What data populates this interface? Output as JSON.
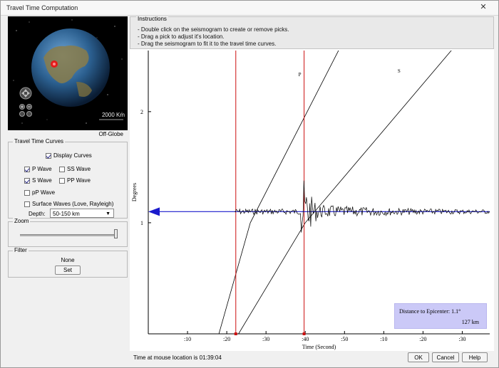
{
  "window": {
    "title": "Travel Time Computation",
    "close_glyph": "✕"
  },
  "globe": {
    "scale_label": "2000 Km",
    "caption": "Off-Globe"
  },
  "travel_time_curves": {
    "label": "Travel Time Curves",
    "display_curves": {
      "label": "Display Curves",
      "checked": true
    },
    "p_wave": {
      "label": "P Wave",
      "checked": true
    },
    "ss_wave": {
      "label": "SS Wave",
      "checked": false
    },
    "s_wave": {
      "label": "S Wave",
      "checked": true
    },
    "pp_wave": {
      "label": "PP Wave",
      "checked": false
    },
    "pp_small": {
      "label": "pP Wave",
      "checked": false
    },
    "surface_waves": {
      "label": "Surface Waves (Love, Rayleigh)",
      "checked": false
    },
    "depth_label": "Depth:",
    "depth_value": "50-150 km"
  },
  "zoom": {
    "label": "Zoom",
    "level": 1.0
  },
  "filter": {
    "label": "Filter",
    "value": "None",
    "set_label": "Set"
  },
  "instructions": {
    "label": "Instructions",
    "lines": [
      "- Double click on the seismogram to create or remove picks.",
      "- Drag a pick to adjust it's location.",
      "- Drag the seismogram to fit it to the travel time curves."
    ]
  },
  "chart_data": {
    "type": "line",
    "xlabel": "Time  (Second)",
    "ylabel": "Degrees",
    "x_tick_labels": [
      ":10",
      ":20",
      ":30",
      ":40",
      ":50",
      ":10",
      ":20",
      ":30"
    ],
    "x_ticks": [
      10,
      20,
      30,
      40,
      50,
      60,
      70,
      80
    ],
    "y_ticks": [
      1,
      2
    ],
    "xlim": [
      0,
      87
    ],
    "ylim": [
      0.0,
      2.55
    ],
    "curves": [
      {
        "name": "P",
        "x": [
          18,
          26,
          55
        ],
        "y": [
          0.0,
          1.0,
          3.0
        ]
      },
      {
        "name": "S",
        "x": [
          23,
          40,
          88
        ],
        "y": [
          0.0,
          1.0,
          3.0
        ]
      }
    ],
    "picks_x": [
      22.3,
      39.7
    ],
    "epicenter_marker_y": 1.1,
    "colors": {
      "curve": "#000000",
      "pick": "#cc1111",
      "marker": "#1a1acc",
      "trace": "#000000"
    }
  },
  "distance": {
    "line1": "Distance to Epicenter: 1.1°",
    "line2": "127 km"
  },
  "status": {
    "text": "Time at mouse location is 01:39:04"
  },
  "buttons": {
    "ok": "OK",
    "cancel": "Cancel",
    "help": "Help"
  }
}
